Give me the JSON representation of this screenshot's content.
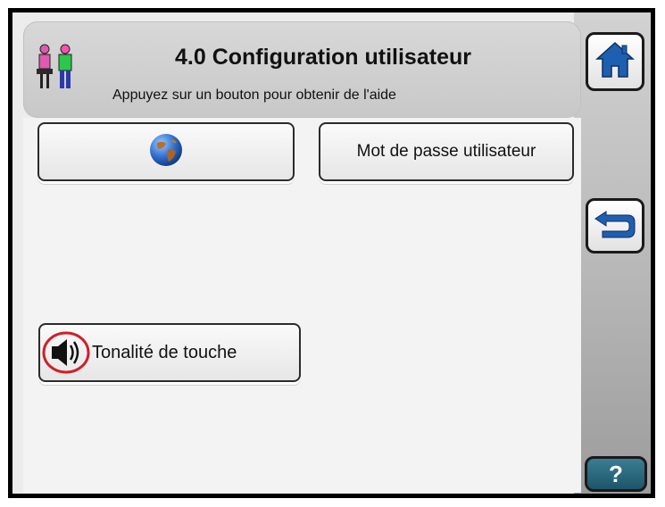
{
  "header": {
    "title": "4.0 Configuration utilisateur",
    "subtitle": "Appuyez sur un bouton pour obtenir de l'aide",
    "icon": "users-icon"
  },
  "buttons": {
    "language_icon": "globe-icon",
    "password_label": "Mot de passe utilisateur",
    "keytone_label": "Tonalité de touche",
    "keytone_icon": "speaker-icon"
  },
  "nav": {
    "home_icon": "home-icon",
    "back_icon": "back-arrow-icon",
    "help_label": "?"
  },
  "colors": {
    "nav_icon_blue": "#1f5fb0",
    "help_button": "#22596d",
    "keytone_ring": "#d0202a"
  }
}
